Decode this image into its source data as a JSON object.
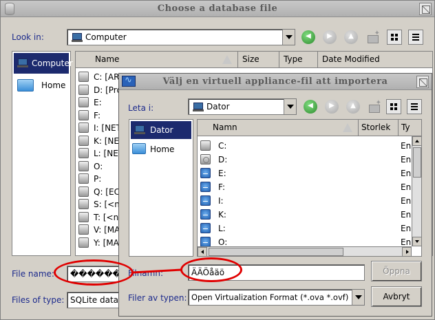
{
  "back_window": {
    "title": "Choose a database file",
    "look_in_label": "Look in:",
    "look_in_value": "Computer",
    "sidebar": [
      {
        "label": "Computer",
        "selected": true
      },
      {
        "label": "Home",
        "selected": false
      }
    ],
    "columns": [
      "Name",
      "Size",
      "Type",
      "Date Modified"
    ],
    "files": [
      "C: [AR",
      "D: [Pro",
      "E:",
      "F:",
      "I: [NET",
      "K: [NET",
      "L: [NET",
      "O:",
      "P:",
      "Q: [EC",
      "S: [<n",
      "T: [<n",
      "V: [MA",
      "Y: [MA"
    ],
    "file_name_label": "File name:",
    "file_name_value": "�������",
    "files_of_type_label": "Files of type:",
    "files_of_type_value": "SQLite datab"
  },
  "front_window": {
    "title": "Välj en virtuell appliance-fil att importera",
    "look_in_label": "Leta i:",
    "look_in_value": "Dator",
    "sidebar": [
      {
        "label": "Dator",
        "selected": true
      },
      {
        "label": "Home",
        "selected": false
      }
    ],
    "columns": [
      "Namn",
      "Storlek",
      "Ty"
    ],
    "files": [
      {
        "name": "C:",
        "kind": "Enh"
      },
      {
        "name": "D:",
        "kind": "Enh"
      },
      {
        "name": "E:",
        "kind": "Enh"
      },
      {
        "name": "F:",
        "kind": "Enh"
      },
      {
        "name": "I:",
        "kind": "Enh"
      },
      {
        "name": "K:",
        "kind": "Enh"
      },
      {
        "name": "L:",
        "kind": "Enh"
      },
      {
        "name": "O:",
        "kind": "Enh"
      }
    ],
    "file_name_label": "Filnamn:",
    "file_name_value": "ÄÄÖåäö",
    "files_of_type_label": "Filer av typen:",
    "files_of_type_value": "Open Virtualization Format (*.ova *.ovf)",
    "open_button": "Öppna",
    "cancel_button": "Avbryt"
  },
  "colors": {
    "selection": "#1c2a6e",
    "label_blue": "#1c2a8c",
    "annotation_red": "#e00000"
  }
}
